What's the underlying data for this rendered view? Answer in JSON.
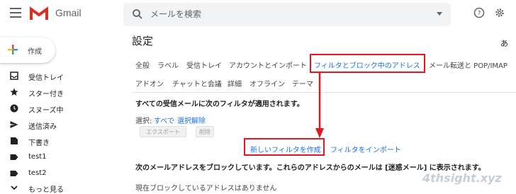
{
  "header": {
    "brand": "Gmail",
    "search_placeholder": "メールを検索"
  },
  "sidebar": {
    "compose": "作成",
    "items": [
      {
        "label": "受信トレイ",
        "icon": "inbox-icon"
      },
      {
        "label": "スター付き",
        "icon": "star-icon"
      },
      {
        "label": "スヌーズ中",
        "icon": "clock-icon"
      },
      {
        "label": "送信済み",
        "icon": "send-icon"
      },
      {
        "label": "下書き",
        "icon": "draft-icon"
      },
      {
        "label": "test1",
        "icon": "label-icon"
      },
      {
        "label": "test2",
        "icon": "label-icon"
      },
      {
        "label": "もっと見る",
        "icon": "expand-icon"
      }
    ]
  },
  "main": {
    "title": "設定",
    "lang": "あ",
    "tabs_row1": [
      "全般",
      "ラベル",
      "受信トレイ",
      "アカウントとインポート",
      "フィルタとブロック中のアドレス",
      "メール転送と POP/IMAP"
    ],
    "tabs_row2": [
      "アドオン",
      "チャットと会議",
      "詳細",
      "オフライン",
      "テーマ"
    ],
    "filters_heading": "すべての受信メールに次のフィルタが適用されます。",
    "select_label": "選択:",
    "select_all": "すべて",
    "select_sep": ",",
    "deselect": "選択解除",
    "export_button": "エクスポート",
    "delete_button": "削除",
    "create_filter": "新しいフィルタを作成",
    "import_filters": "フィルタをインポート",
    "blocked_heading": "次のメールアドレスをブロックしています。これらのアドレスからのメールは [迷惑メール] に表示されます。",
    "blocked_empty": "現在ブロックしているアドレスはありません"
  },
  "watermark": "4thsight.xyz",
  "colors": {
    "accent": "#1a73e8",
    "highlight": "#e8141e"
  }
}
